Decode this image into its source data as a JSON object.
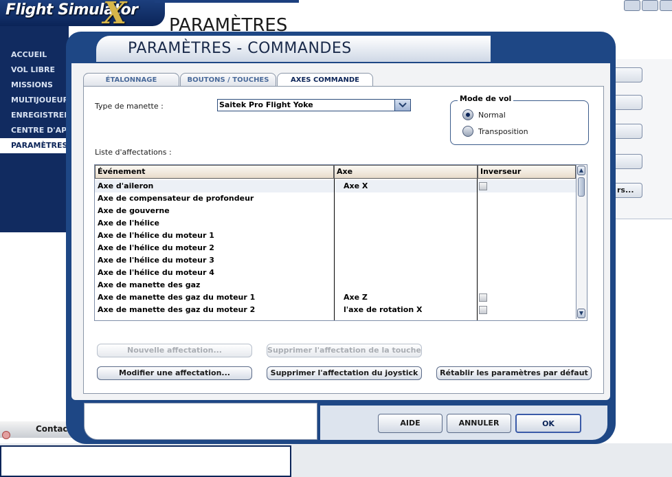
{
  "app": {
    "brand": "Flight Simulator",
    "brand_x": "X",
    "page_title": "PARAMÈTRES"
  },
  "sidebar": {
    "items": [
      {
        "label": "ACCUEIL",
        "active": false
      },
      {
        "label": "VOL LIBRE",
        "active": false
      },
      {
        "label": "MISSIONS",
        "active": false
      },
      {
        "label": "MULTIJOUEUR",
        "active": false
      },
      {
        "label": "ENREGISTREMENT",
        "active": false
      },
      {
        "label": "CENTRE D'APPRENTISSAGE",
        "active": false
      },
      {
        "label": "PARAMÈTRES",
        "active": true
      }
    ]
  },
  "background": {
    "partial_button_label": "rs...",
    "contacts_label": "Contacts"
  },
  "dialog": {
    "title": "PARAMÈTRES - COMMANDES",
    "tabs": [
      {
        "label": "ÉTALONNAGE",
        "active": false
      },
      {
        "label": "BOUTONS / TOUCHES",
        "active": false
      },
      {
        "label": "AXES COMMANDE",
        "active": true
      }
    ],
    "controller_type_label": "Type de manette :",
    "controller_type_value": "Saitek Pro Flight Yoke",
    "flight_mode": {
      "title": "Mode de vol",
      "options": [
        {
          "label": "Normal",
          "selected": true
        },
        {
          "label": "Transposition",
          "selected": false
        }
      ]
    },
    "assignments_label": "Liste d'affectations :",
    "table": {
      "headers": [
        "Événement",
        "Axe",
        "Inverseur"
      ],
      "rows": [
        {
          "event": "Axe d'aileron",
          "axis": "Axe X",
          "has_reverse": true,
          "selected": true
        },
        {
          "event": "Axe de compensateur de profondeur",
          "axis": "",
          "has_reverse": false,
          "selected": false
        },
        {
          "event": "Axe de gouverne",
          "axis": "",
          "has_reverse": false,
          "selected": false
        },
        {
          "event": "Axe de l'hélice",
          "axis": "",
          "has_reverse": false,
          "selected": false
        },
        {
          "event": "Axe de l'hélice du moteur 1",
          "axis": "",
          "has_reverse": false,
          "selected": false
        },
        {
          "event": "Axe de l'hélice du moteur 2",
          "axis": "",
          "has_reverse": false,
          "selected": false
        },
        {
          "event": "Axe de l'hélice du moteur 3",
          "axis": "",
          "has_reverse": false,
          "selected": false
        },
        {
          "event": "Axe de l'hélice du moteur 4",
          "axis": "",
          "has_reverse": false,
          "selected": false
        },
        {
          "event": "Axe de manette des gaz",
          "axis": "",
          "has_reverse": false,
          "selected": false
        },
        {
          "event": "Axe de manette des gaz du moteur 1",
          "axis": "Axe Z",
          "has_reverse": true,
          "selected": false
        },
        {
          "event": "Axe de manette des gaz du moteur 2",
          "axis": "l'axe de rotation X",
          "has_reverse": true,
          "selected": false
        }
      ]
    },
    "buttons": {
      "new_assignment": "Nouvelle affectation...",
      "delete_key_assignment": "Supprimer l'affectation de la touche",
      "modify_assignment": "Modifier une affectation...",
      "delete_joystick_assignment": "Supprimer l'affectation du joystick",
      "reset_defaults": "Rétablir les paramètres par défaut"
    },
    "footer": {
      "help": "AIDE",
      "cancel": "ANNULER",
      "ok": "OK"
    }
  }
}
